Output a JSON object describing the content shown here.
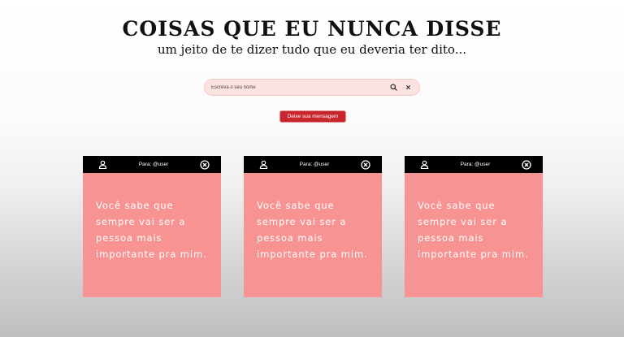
{
  "header": {
    "title": "COISAS QUE EU NUNCA DISSE",
    "subtitle": "um jeito de te dizer tudo que eu deveria ter dito..."
  },
  "search": {
    "placeholder": "Escreva o seu nome",
    "value": "",
    "search_icon": "search-icon",
    "clear_icon": "close-icon"
  },
  "cta": {
    "label": "Deixe sua mensagem"
  },
  "colors": {
    "accent": "#c7262c",
    "card_background": "#f79393",
    "card_header": "#000000",
    "search_background": "#fce3e1"
  },
  "cards": [
    {
      "recipient": "Para: @user",
      "message": "Você sabe que sempre vai ser a pessoa mais importante pra mim."
    },
    {
      "recipient": "Para: @user",
      "message": "Você sabe que sempre vai ser a pessoa mais importante pra mim."
    },
    {
      "recipient": "Para: @user",
      "message": "Você sabe que sempre vai ser a pessoa mais importante pra mim."
    }
  ]
}
